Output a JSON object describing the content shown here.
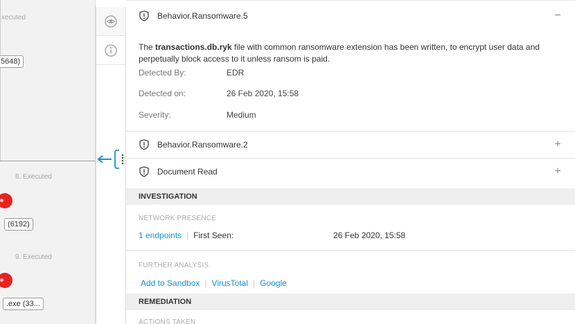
{
  "left_panel": {
    "step_top": "xecuted",
    "node_top": "5648)",
    "step_mid": "8. Executed",
    "node_mid": "(6192)",
    "step_bottom": "9. Executed",
    "node_bottom": ".exe (33..."
  },
  "rail": {
    "items": [
      {
        "name": "process-view"
      },
      {
        "name": "info"
      }
    ]
  },
  "detections": [
    {
      "title": "Behavior.Ransomware.5",
      "expanded": true,
      "toggle": "−",
      "description_prefix": "The ",
      "description_file": "transactions.db.ryk",
      "description_suffix": " file with common ransomware extension has been written, to encrypt user data and perpetually block access to it unless ransom is paid.",
      "fields": [
        {
          "label": "Detected By:",
          "value": "EDR"
        },
        {
          "label": "Detected on:",
          "value": "26 Feb 2020, 15:58"
        },
        {
          "label": "Severity:",
          "value": "Medium"
        }
      ]
    },
    {
      "title": "Behavior.Ransomware.2",
      "expanded": false,
      "toggle": "+"
    },
    {
      "title": "Document Read",
      "expanded": false,
      "toggle": "+"
    }
  ],
  "investigation": {
    "title": "INVESTIGATION",
    "network_presence": {
      "heading": "NETWORK PRESENCE",
      "endpoints_link": "1 endpoints",
      "first_seen_label": "First Seen:",
      "first_seen_value": "26 Feb 2020, 15:58"
    },
    "further_analysis": {
      "heading": "FURTHER ANALYSIS",
      "links": [
        "Add to Sandbox",
        "VirusTotal",
        "Google"
      ]
    }
  },
  "remediation": {
    "title": "REMEDIATION",
    "actions_heading": "ACTIONS TAKEN"
  },
  "colors": {
    "link": "#1a8fd0",
    "alert_red": "#e8231f",
    "handle_blue": "#1a8fd0"
  }
}
